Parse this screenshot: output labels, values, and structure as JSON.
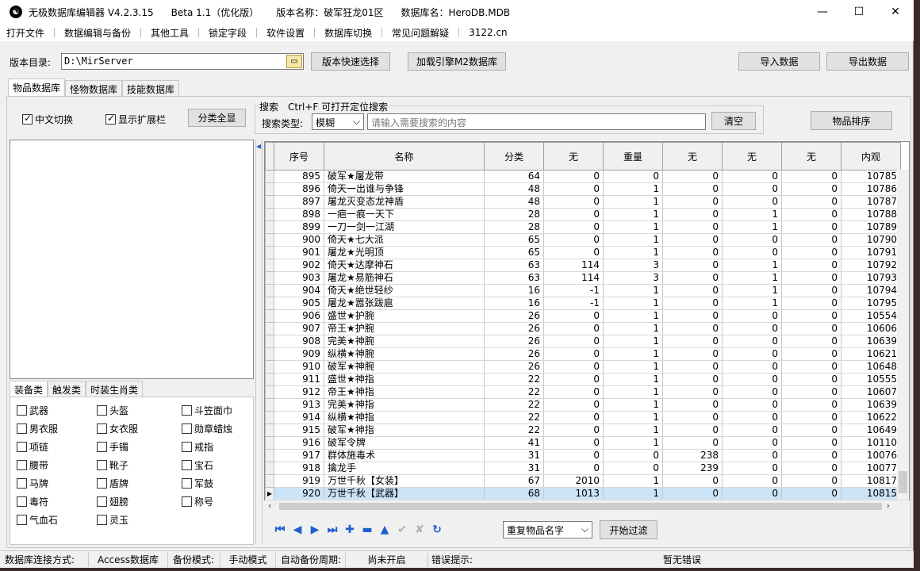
{
  "titlebar": {
    "app_name": "无极数据库编辑器 V4.2.3.15",
    "beta": "Beta 1.1（优化版）",
    "version_name": "版本名称：破军狂龙01区",
    "db_name": "数据库名：HeroDB.MDB",
    "minimize": "—",
    "maximize": "☐",
    "close": "✕"
  },
  "menu": [
    "打开文件",
    "数据编辑与备份",
    "其他工具",
    "锁定字段",
    "软件设置",
    "数据库切换",
    "常见问题解疑",
    "3122.cn"
  ],
  "toolbar": {
    "dir_label": "版本目录:",
    "dir_value": "D:\\MirServer",
    "quick_select": "版本快速选择",
    "load_m2": "加载引擎M2数据库",
    "import": "导入数据",
    "export": "导出数据"
  },
  "main_tabs": [
    "物品数据库",
    "怪物数据库",
    "技能数据库"
  ],
  "options": {
    "chinese_switch": "中文切换",
    "show_ext": "显示扩展栏",
    "show_all_categories": "分类全显",
    "search_group": "搜索　Ctrl+F 可打开定位搜索",
    "search_type_label": "搜索类型:",
    "search_type_value": "模糊",
    "search_placeholder": "请输入需要搜索的内容",
    "clear": "清空",
    "sort_items": "物品排序"
  },
  "category_tabs": [
    "装备类",
    "触发类",
    "时装生肖类"
  ],
  "categories": [
    [
      "武器",
      "头盔",
      "斗笠面巾"
    ],
    [
      "男衣服",
      "女衣服",
      "勋章蜡烛"
    ],
    [
      "项链",
      "手镯",
      "戒指"
    ],
    [
      "腰带",
      "靴子",
      "宝石"
    ],
    [
      "马牌",
      "盾牌",
      "军鼓"
    ],
    [
      "毒符",
      "翅膀",
      "称号"
    ],
    [
      "气血石",
      "灵玉"
    ]
  ],
  "grid": {
    "headers": [
      "序号",
      "名称",
      "分类",
      "无",
      "重量",
      "无",
      "无",
      "无",
      "内观"
    ],
    "rows": [
      [
        "895",
        "破军★屠龙带",
        "64",
        "0",
        "0",
        "0",
        "0",
        "0",
        "10785"
      ],
      [
        "896",
        "倚天一出谁与争锋",
        "48",
        "0",
        "1",
        "0",
        "0",
        "0",
        "10786"
      ],
      [
        "897",
        "屠龙灭变态龙神盾",
        "48",
        "0",
        "1",
        "0",
        "0",
        "0",
        "10787"
      ],
      [
        "898",
        "一疤一痕一天下",
        "28",
        "0",
        "1",
        "0",
        "1",
        "0",
        "10788"
      ],
      [
        "899",
        "一刀一剑一江湖",
        "28",
        "0",
        "1",
        "0",
        "1",
        "0",
        "10789"
      ],
      [
        "900",
        "倚天★七大派",
        "65",
        "0",
        "1",
        "0",
        "0",
        "0",
        "10790"
      ],
      [
        "901",
        "屠龙★光明顶",
        "65",
        "0",
        "1",
        "0",
        "0",
        "0",
        "10791"
      ],
      [
        "902",
        "倚天★达摩神石",
        "63",
        "114",
        "3",
        "0",
        "1",
        "0",
        "10792"
      ],
      [
        "903",
        "屠龙★易筋神石",
        "63",
        "114",
        "3",
        "0",
        "1",
        "0",
        "10793"
      ],
      [
        "904",
        "倚天★绝世轻纱",
        "16",
        "-1",
        "1",
        "0",
        "1",
        "0",
        "10794"
      ],
      [
        "905",
        "屠龙★嚣张跋扈",
        "16",
        "-1",
        "1",
        "0",
        "1",
        "0",
        "10795"
      ],
      [
        "906",
        "盛世★护腕",
        "26",
        "0",
        "1",
        "0",
        "0",
        "0",
        "10554"
      ],
      [
        "907",
        "帝王★护腕",
        "26",
        "0",
        "1",
        "0",
        "0",
        "0",
        "10606"
      ],
      [
        "908",
        "完美★神腕",
        "26",
        "0",
        "1",
        "0",
        "0",
        "0",
        "10639"
      ],
      [
        "909",
        "纵横★神腕",
        "26",
        "0",
        "1",
        "0",
        "0",
        "0",
        "10621"
      ],
      [
        "910",
        "破军★神腕",
        "26",
        "0",
        "1",
        "0",
        "0",
        "0",
        "10648"
      ],
      [
        "911",
        "盛世★神指",
        "22",
        "0",
        "1",
        "0",
        "0",
        "0",
        "10555"
      ],
      [
        "912",
        "帝王★神指",
        "22",
        "0",
        "1",
        "0",
        "0",
        "0",
        "10607"
      ],
      [
        "913",
        "完美★神指",
        "22",
        "0",
        "1",
        "0",
        "0",
        "0",
        "10639"
      ],
      [
        "914",
        "纵横★神指",
        "22",
        "0",
        "1",
        "0",
        "0",
        "0",
        "10622"
      ],
      [
        "915",
        "破军★神指",
        "22",
        "0",
        "1",
        "0",
        "0",
        "0",
        "10649"
      ],
      [
        "916",
        "破军令牌",
        "41",
        "0",
        "1",
        "0",
        "0",
        "0",
        "10110"
      ],
      [
        "917",
        "群体施毒术",
        "31",
        "0",
        "0",
        "238",
        "0",
        "0",
        "10076"
      ],
      [
        "918",
        "擒龙手",
        "31",
        "0",
        "0",
        "239",
        "0",
        "0",
        "10077"
      ],
      [
        "919",
        "万世千秋【女装】",
        "67",
        "2010",
        "1",
        "0",
        "0",
        "0",
        "10817"
      ],
      [
        "920",
        "万世千秋【武器】",
        "68",
        "1013",
        "1",
        "0",
        "0",
        "0",
        "10815"
      ]
    ],
    "selected_row": "920"
  },
  "navigator": {
    "dup_select": "重复物品名字",
    "start_filter": "开始过滤"
  },
  "status": {
    "conn_label": "数据库连接方式:",
    "conn_value": "Access数据库",
    "backup_label": "备份模式:",
    "backup_value": "手动模式",
    "auto_label": "自动备份周期:",
    "auto_value": "尚未开启",
    "err_label": "错误提示:",
    "err_value": "暂无错误"
  }
}
